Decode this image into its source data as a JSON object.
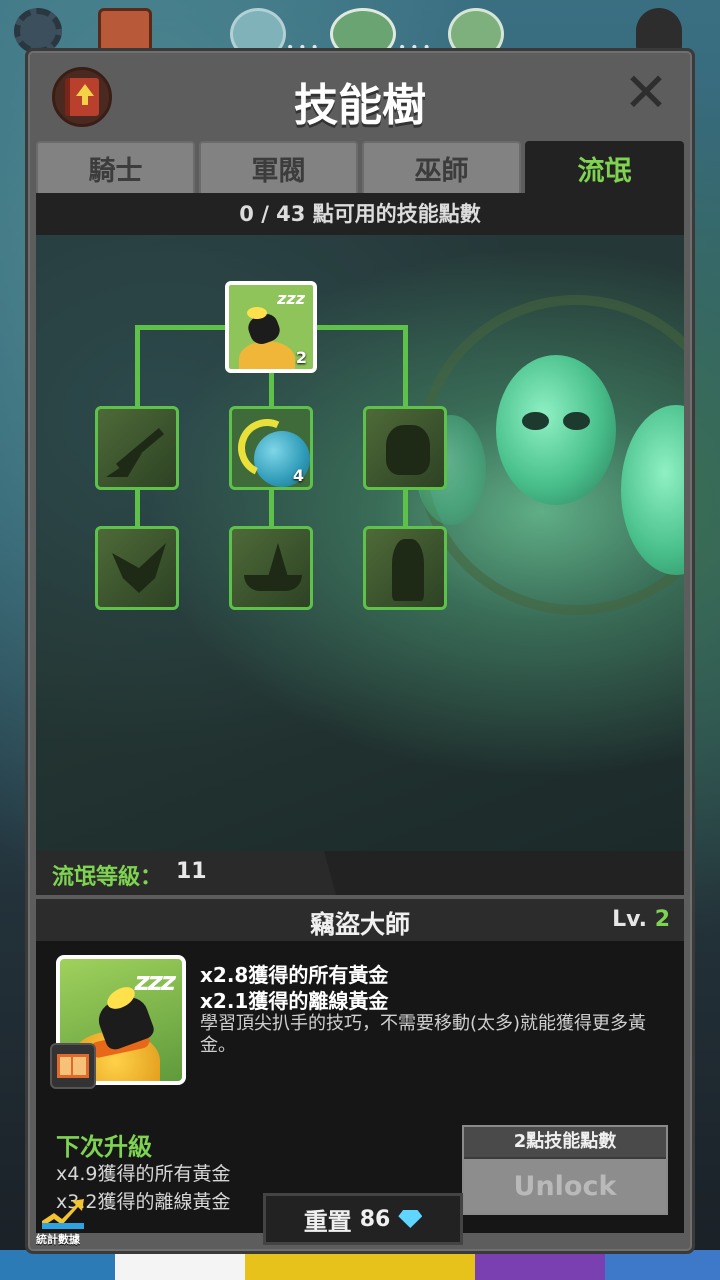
{
  "header": {
    "title": "技能樹",
    "close_symbol": "✕"
  },
  "tabs": [
    {
      "label": "騎士",
      "active": false
    },
    {
      "label": "軍閥",
      "active": false
    },
    {
      "label": "巫師",
      "active": false
    },
    {
      "label": "流氓",
      "active": true
    }
  ],
  "points_text": "0 / 43 點可用的技能點數",
  "skill_tree": {
    "nodes": [
      {
        "id": "master-thief",
        "level": "2",
        "state": "selected"
      },
      {
        "id": "blade-skill",
        "level": "",
        "state": "locked"
      },
      {
        "id": "world-skill",
        "level": "4",
        "state": "unlocked"
      },
      {
        "id": "goblin-skill",
        "level": "",
        "state": "locked"
      },
      {
        "id": "fairy-skill",
        "level": "",
        "state": "locked"
      },
      {
        "id": "ship-skill",
        "level": "",
        "state": "locked"
      },
      {
        "id": "warrior-skill",
        "level": "",
        "state": "locked"
      }
    ]
  },
  "class_level": {
    "label": "流氓等級：",
    "value": "11"
  },
  "detail": {
    "name": "竊盜大師",
    "lv_prefix": "Lv.",
    "lv_value": "2",
    "effect1": "x2.8獲得的所有黃金",
    "effect2": "x2.1獲得的離線黃金",
    "description": "學習頂尖扒手的技巧，不需要移動(太多)就能獲得更多黃金。",
    "icon_text": "zzz",
    "next_title": "下次升級",
    "next1": "x4.9獲得的所有黃金",
    "next2": "x3.2獲得的離線黃金",
    "unlock_cost": "2點技能點數",
    "unlock_label": "Unlock"
  },
  "footer": {
    "reset_label": "重置",
    "reset_cost": "86",
    "stats_label": "統計數據"
  },
  "colors": {
    "accent_green": "#7ed351",
    "tree_line": "#5ec24a"
  }
}
